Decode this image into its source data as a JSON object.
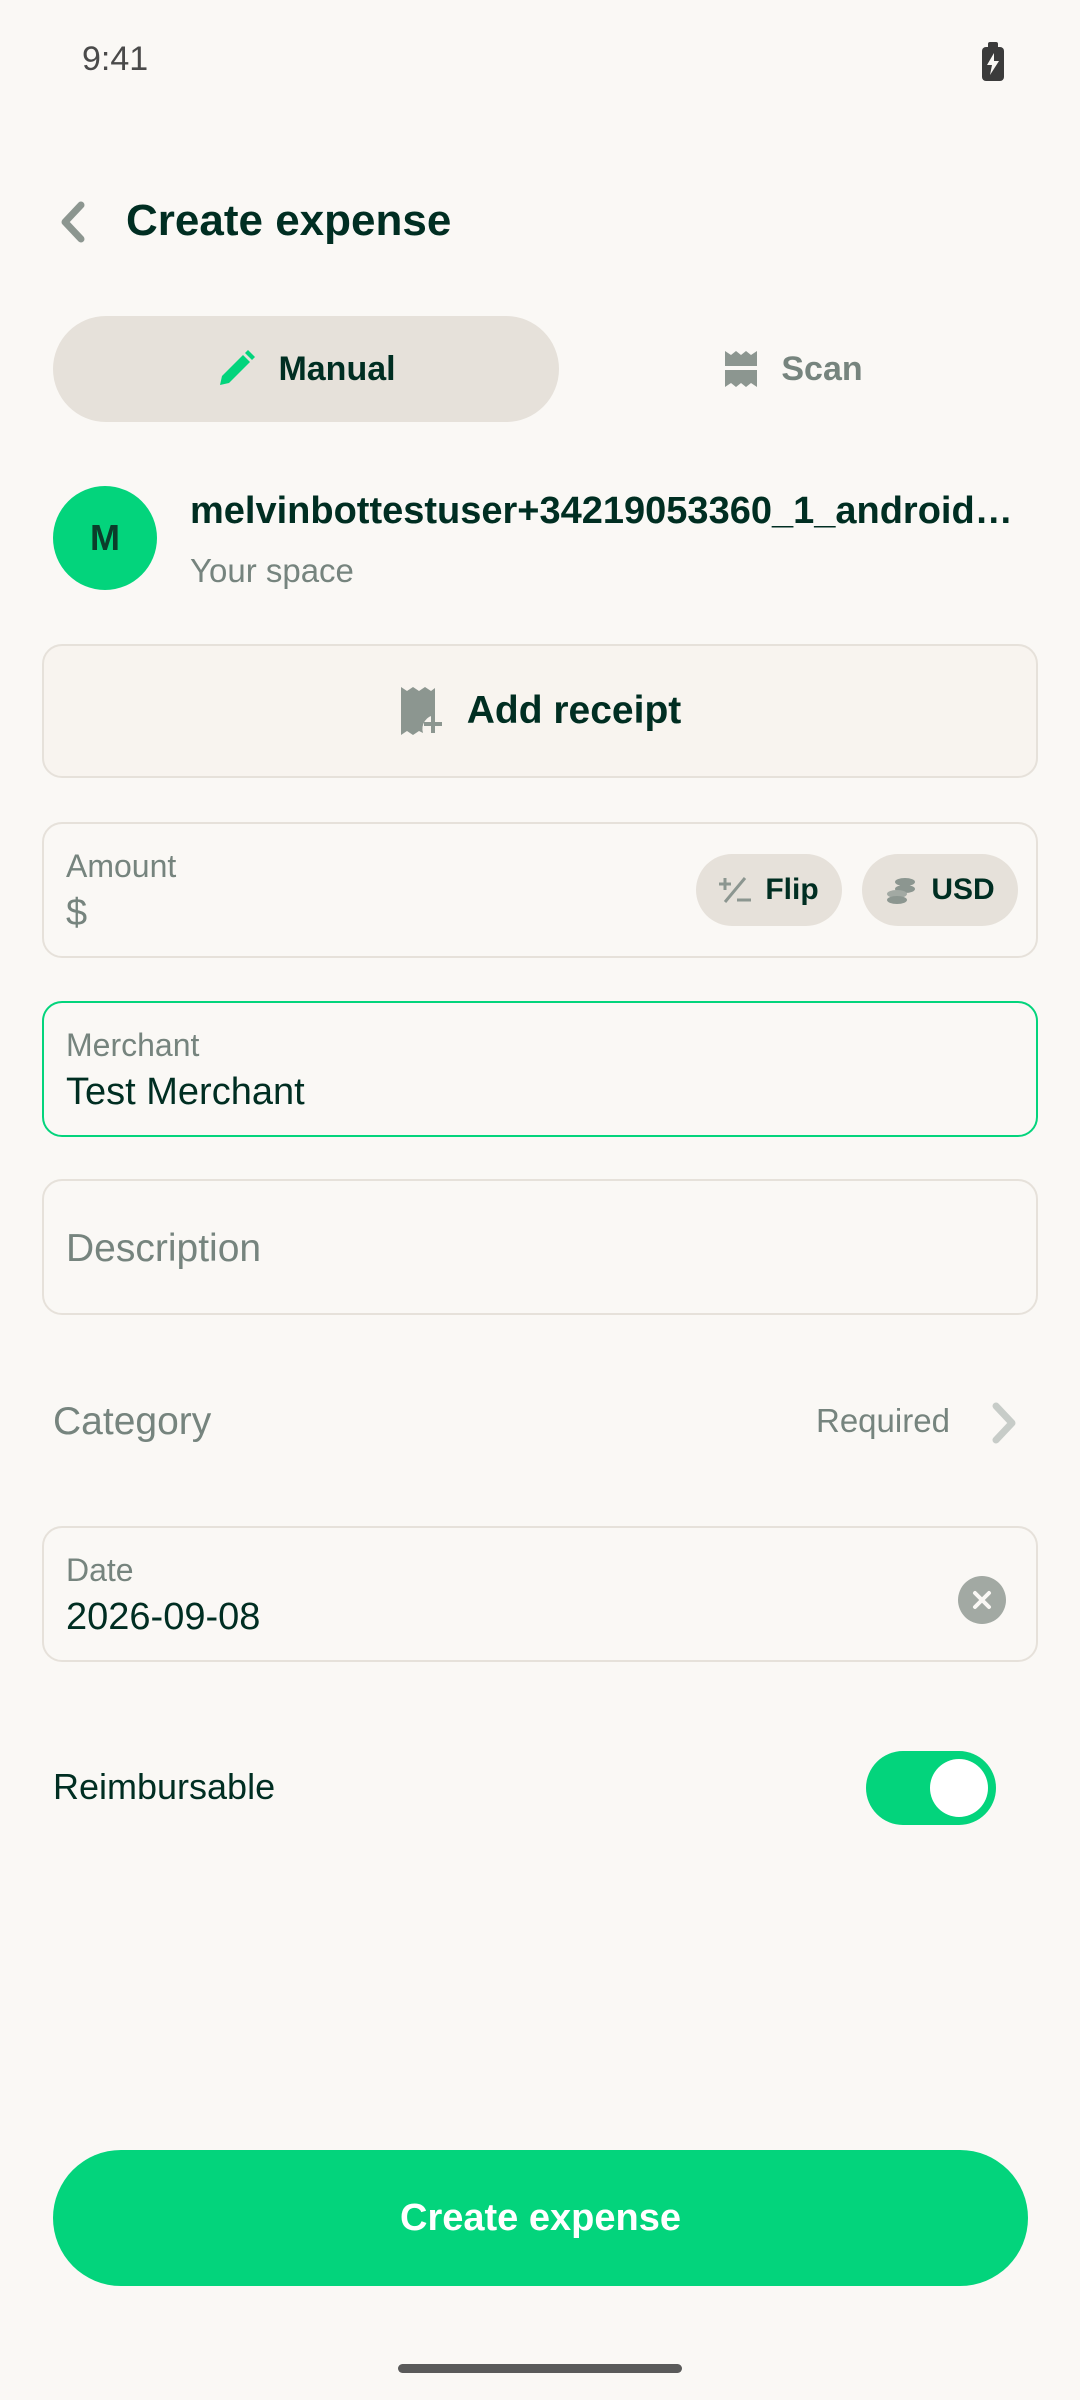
{
  "status_bar": {
    "time": "9:41"
  },
  "header": {
    "title": "Create expense"
  },
  "tabs": [
    {
      "label": "Manual",
      "icon": "pencil-icon",
      "selected": true
    },
    {
      "label": "Scan",
      "icon": "receipt-scan-icon",
      "selected": false
    }
  ],
  "workspace": {
    "avatar_letter": "M",
    "name": "melvinbottestuser+34219053360_1_android_...",
    "subtitle": "Your space"
  },
  "receipt": {
    "label": "Add receipt"
  },
  "amount": {
    "label": "Amount",
    "value": "$",
    "flip_label": "Flip",
    "currency_label": "USD"
  },
  "merchant": {
    "label": "Merchant",
    "value": "Test Merchant"
  },
  "description": {
    "placeholder": "Description"
  },
  "category": {
    "label": "Category",
    "status": "Required"
  },
  "date": {
    "label": "Date",
    "value": "2026-09-08"
  },
  "reimbursable": {
    "label": "Reimbursable",
    "enabled": true
  },
  "submit": {
    "label": "Create expense"
  },
  "colors": {
    "accent": "#03D47C",
    "text_dark": "#002E22",
    "text_muted": "#76847E",
    "chip_bg": "#E6E1DA",
    "background": "#FAF8F5"
  }
}
